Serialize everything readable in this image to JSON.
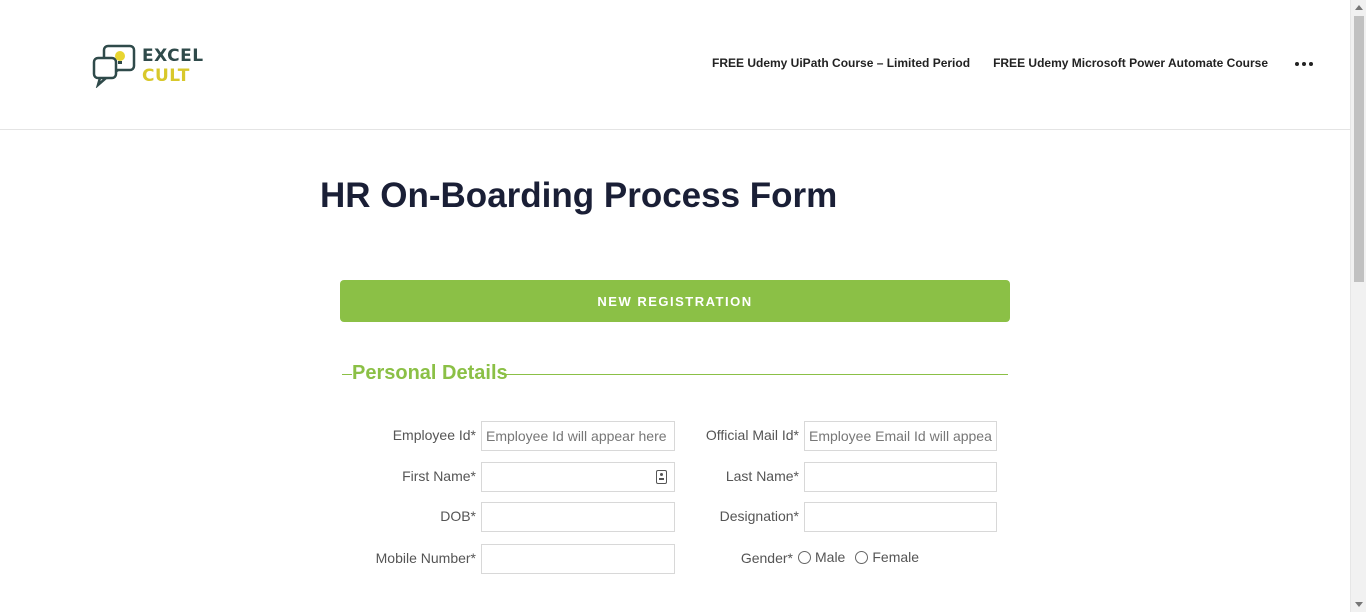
{
  "logo": {
    "line1": "EXCEL",
    "line2": "CULT"
  },
  "nav": {
    "items": [
      {
        "label": "FREE Udemy UiPath Course – Limited Period"
      },
      {
        "label": "FREE Udemy Microsoft Power Automate Course"
      }
    ],
    "more_icon": "ellipsis-icon"
  },
  "page": {
    "title": "HR On-Boarding Process Form"
  },
  "registration_button": {
    "label": "NEW REGISTRATION"
  },
  "section": {
    "title": "Personal Details"
  },
  "form": {
    "employee_id": {
      "label": "Employee Id*",
      "placeholder": "Employee Id will appear here",
      "value": ""
    },
    "official_mail": {
      "label": "Official Mail Id*",
      "placeholder": "Employee Email Id will appear",
      "value": ""
    },
    "first_name": {
      "label": "First Name*",
      "value": ""
    },
    "last_name": {
      "label": "Last Name*",
      "value": ""
    },
    "dob": {
      "label": "DOB*",
      "value": ""
    },
    "designation": {
      "label": "Designation*",
      "value": ""
    },
    "mobile": {
      "label": "Mobile Number*",
      "value": ""
    },
    "gender": {
      "label": "Gender*",
      "options": [
        "Male",
        "Female"
      ]
    }
  },
  "colors": {
    "accent": "#8bc046",
    "title": "#1a1f36",
    "logo_dark": "#2f4a4a",
    "logo_yellow": "#d8c82b"
  }
}
